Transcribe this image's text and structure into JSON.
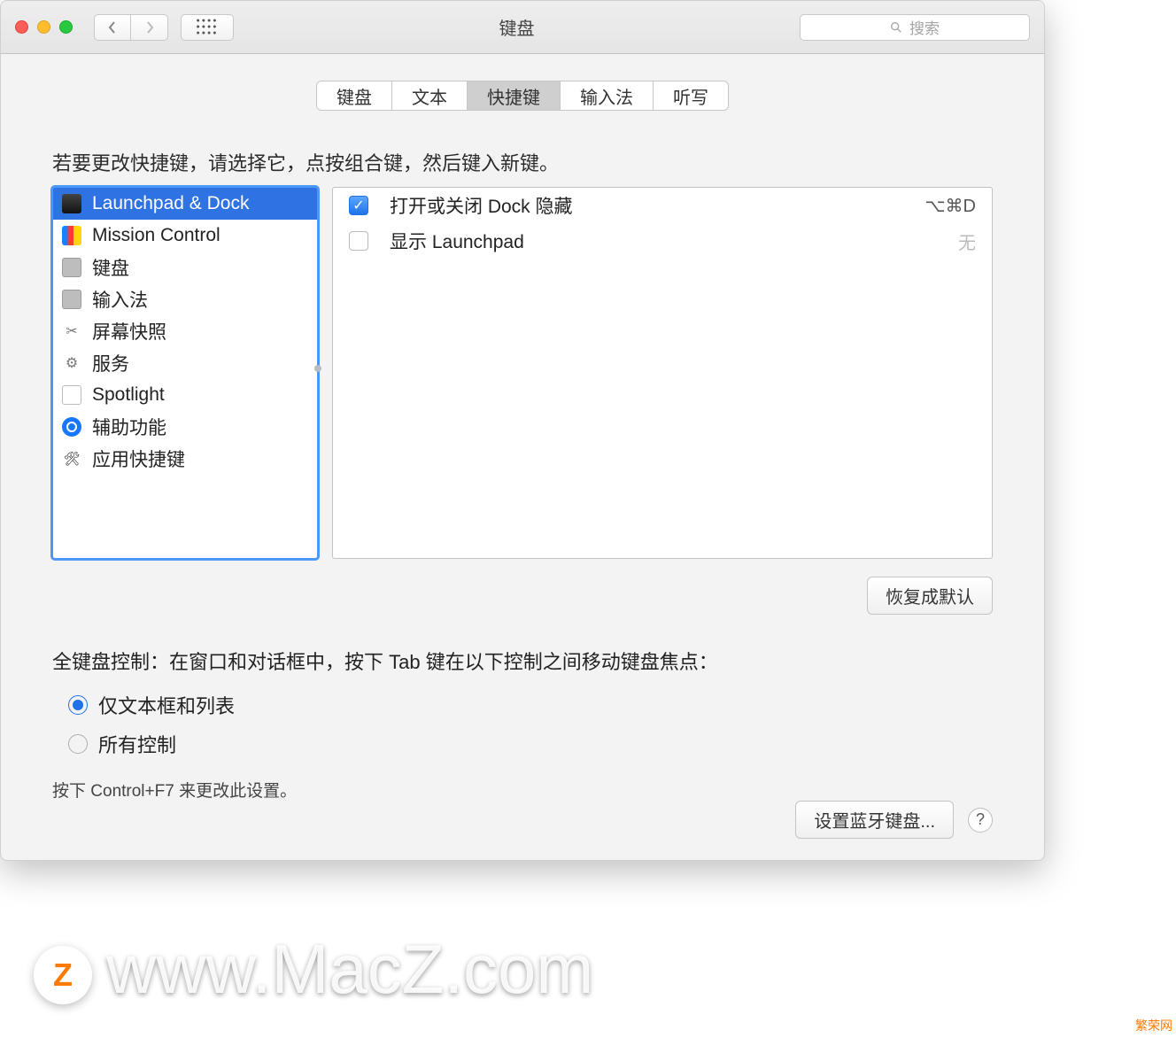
{
  "window_title": "键盘",
  "search_placeholder": "搜索",
  "tabs": [
    "键盘",
    "文本",
    "快捷键",
    "输入法",
    "听写"
  ],
  "active_tab_index": 2,
  "instruction": "若要更改快捷键，请选择它，点按组合键，然后键入新键。",
  "categories": [
    {
      "id": "launchpad-dock",
      "label": "Launchpad & Dock"
    },
    {
      "id": "mission-control",
      "label": "Mission Control"
    },
    {
      "id": "keyboard",
      "label": "键盘"
    },
    {
      "id": "input",
      "label": "输入法"
    },
    {
      "id": "screenshot",
      "label": "屏幕快照"
    },
    {
      "id": "services",
      "label": "服务"
    },
    {
      "id": "spotlight",
      "label": "Spotlight"
    },
    {
      "id": "accessibility",
      "label": "辅助功能"
    },
    {
      "id": "app-shortcuts",
      "label": "应用快捷键"
    }
  ],
  "selected_category_index": 0,
  "shortcuts": [
    {
      "enabled": true,
      "label": "打开或关闭 Dock 隐藏",
      "key": "⌥⌘D"
    },
    {
      "enabled": false,
      "label": "显示 Launchpad",
      "key": "无"
    }
  ],
  "restore_button": "恢复成默认",
  "full_kb_label": "全键盘控制：在窗口和对话框中，按下 Tab 键在以下控制之间移动键盘焦点：",
  "radio_options": [
    "仅文本框和列表",
    "所有控制"
  ],
  "radio_selected_index": 0,
  "kb_hint": "按下 Control+F7 来更改此设置。",
  "bluetooth_button": "设置蓝牙键盘...",
  "watermark_logo": "Z",
  "watermark_text": "www.MacZ.com",
  "watermark_corner": "繁荣网"
}
